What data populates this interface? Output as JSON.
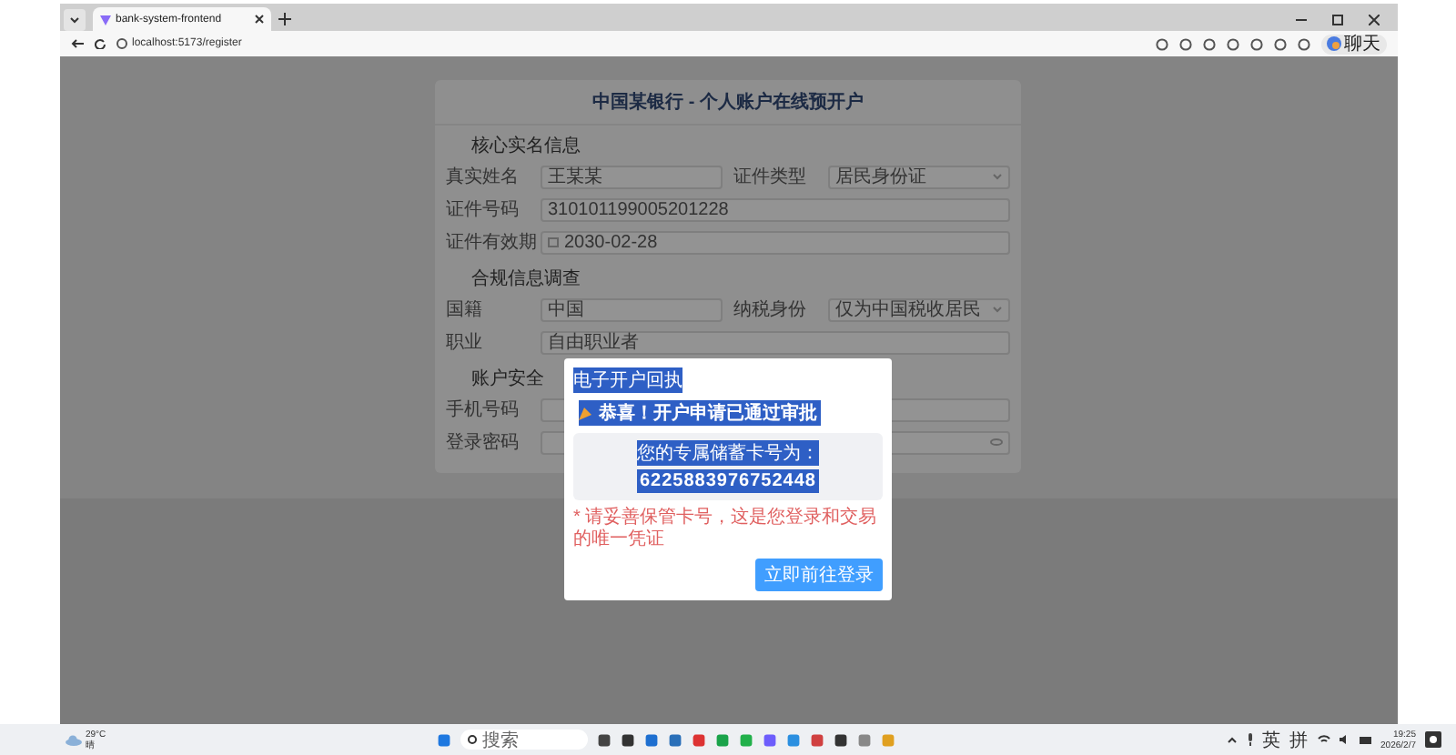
{
  "browser": {
    "tab": {
      "title": "bank-system-frontend",
      "selected": true
    },
    "url": "localhost:5173/register",
    "copilot_label": "聊天"
  },
  "form": {
    "title": "中国某银行 - 个人账户在线预开户",
    "sections": [
      {
        "title": "核心实名信息",
        "rows": [
          [
            {
              "label": "真实姓名",
              "value": "王某某",
              "kind": "text"
            },
            {
              "label": "证件类型",
              "value": "居民身份证",
              "kind": "select"
            }
          ],
          [
            {
              "label": "证件号码",
              "value": "310101199005201228",
              "kind": "text"
            }
          ],
          [
            {
              "label": "证件有效期",
              "value": "2030-02-28",
              "kind": "date"
            }
          ]
        ]
      },
      {
        "title": "合规信息调查",
        "rows": [
          [
            {
              "label": "国籍",
              "value": "中国",
              "kind": "text"
            },
            {
              "label": "纳税身份",
              "value": "仅为中国税收居民",
              "kind": "select"
            }
          ],
          [
            {
              "label": "职业",
              "value": "自由职业者",
              "kind": "text"
            }
          ]
        ]
      },
      {
        "title": "账户安全",
        "rows": [
          [
            {
              "label": "手机号码",
              "kind": "text"
            }
          ],
          [
            {
              "label": "登录密码",
              "kind": "password"
            }
          ]
        ]
      }
    ]
  },
  "dialog": {
    "title": "电子开户回执",
    "text_selected": true,
    "message": "恭喜！开户申请已通过审批",
    "card_label": "您的专属储蓄卡号为：",
    "card_number": "6225883976752448",
    "note": "* 请妥善保管卡号，这是您登录和交易的唯一凭证",
    "button": "立即前往登录"
  },
  "taskbar": {
    "weather": {
      "temp": "29°C",
      "condition": "晴"
    },
    "search": {
      "placeholder": "搜索"
    },
    "ime": [
      "英",
      "拼"
    ],
    "time": "19:25",
    "date": "2026/2/7"
  }
}
